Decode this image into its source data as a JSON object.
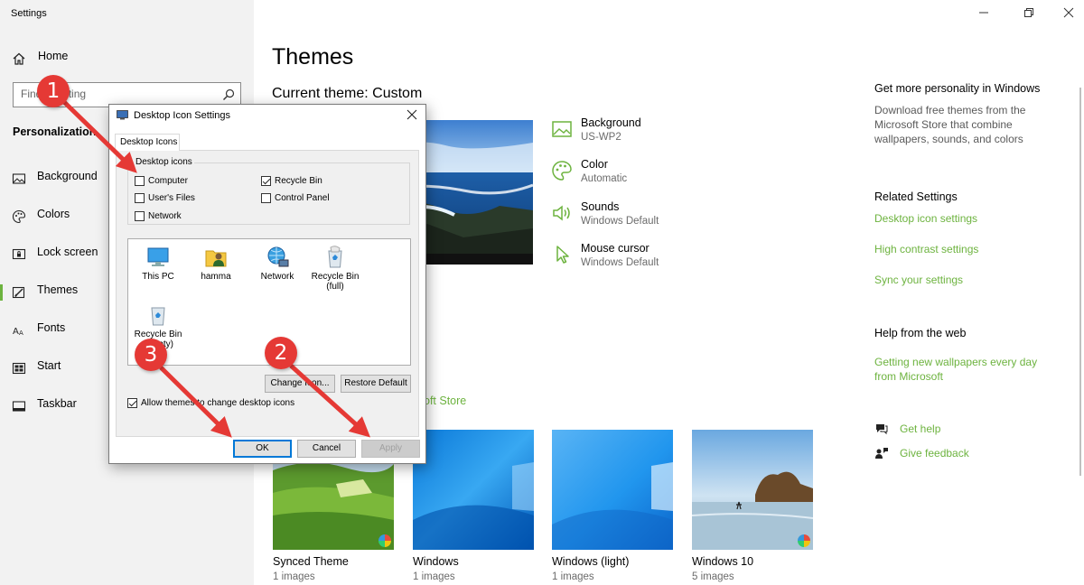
{
  "app": {
    "title": "Settings"
  },
  "sidebar": {
    "home_label": "Home",
    "search_placeholder": "Find a setting",
    "section_label": "Personalization",
    "items": [
      {
        "label": "Background",
        "icon": "picture-icon"
      },
      {
        "label": "Colors",
        "icon": "palette-icon"
      },
      {
        "label": "Lock screen",
        "icon": "lock-screen-icon"
      },
      {
        "label": "Themes",
        "icon": "themes-icon",
        "active": true
      },
      {
        "label": "Fonts",
        "icon": "fonts-icon"
      },
      {
        "label": "Start",
        "icon": "start-icon"
      },
      {
        "label": "Taskbar",
        "icon": "taskbar-icon"
      }
    ]
  },
  "main": {
    "title": "Themes",
    "current_theme": "Current theme: Custom",
    "properties": [
      {
        "name": "Background",
        "value": "US-WP2",
        "icon": "picture-icon"
      },
      {
        "name": "Color",
        "value": "Automatic",
        "icon": "palette-icon"
      },
      {
        "name": "Sounds",
        "value": "Windows Default",
        "icon": "speaker-icon"
      },
      {
        "name": "Mouse cursor",
        "value": "Windows Default",
        "icon": "cursor-icon"
      }
    ],
    "store_link_partial": "oft Store",
    "themes": [
      {
        "name": "Synced Theme",
        "count": "1 images"
      },
      {
        "name": "Windows",
        "count": "1 images"
      },
      {
        "name": "Windows (light)",
        "count": "1 images"
      },
      {
        "name": "Windows 10",
        "count": "5 images"
      }
    ]
  },
  "right": {
    "personality_title": "Get more personality in Windows",
    "personality_desc": "Download free themes from the Microsoft Store that combine wallpapers, sounds, and colors",
    "related_title": "Related Settings",
    "related_links": [
      "Desktop icon settings",
      "High contrast settings",
      "Sync your settings"
    ],
    "help_title": "Help from the web",
    "help_link": "Getting new wallpapers every day from Microsoft",
    "get_help": "Get help",
    "give_feedback": "Give feedback"
  },
  "dialog": {
    "title": "Desktop Icon Settings",
    "tab": "Desktop Icons",
    "group_label": "Desktop icons",
    "checkboxes": [
      {
        "label": "Computer",
        "checked": false
      },
      {
        "label": "Recycle Bin",
        "checked": true
      },
      {
        "label": "User's Files",
        "checked": false
      },
      {
        "label": "Control Panel",
        "checked": false
      },
      {
        "label": "Network",
        "checked": false
      }
    ],
    "icons": [
      {
        "label": "This PC",
        "icon": "computer-icon"
      },
      {
        "label": "hamma",
        "icon": "user-folder-icon"
      },
      {
        "label": "Network",
        "icon": "network-icon"
      },
      {
        "label": "Recycle Bin (full)",
        "icon": "recycle-bin-full-icon"
      },
      {
        "label": "Recycle Bin (empty)",
        "icon": "recycle-bin-empty-icon"
      }
    ],
    "change_icon": "Change Icon...",
    "restore_default": "Restore Default",
    "allow_themes": "Allow themes to change desktop icons",
    "allow_checked": true,
    "ok": "OK",
    "cancel": "Cancel",
    "apply": "Apply"
  },
  "annotations": [
    "1",
    "2",
    "3"
  ],
  "colors": {
    "accent": "#6db33f",
    "annotation": "#e53935",
    "dialog_focus": "#0078d7"
  }
}
